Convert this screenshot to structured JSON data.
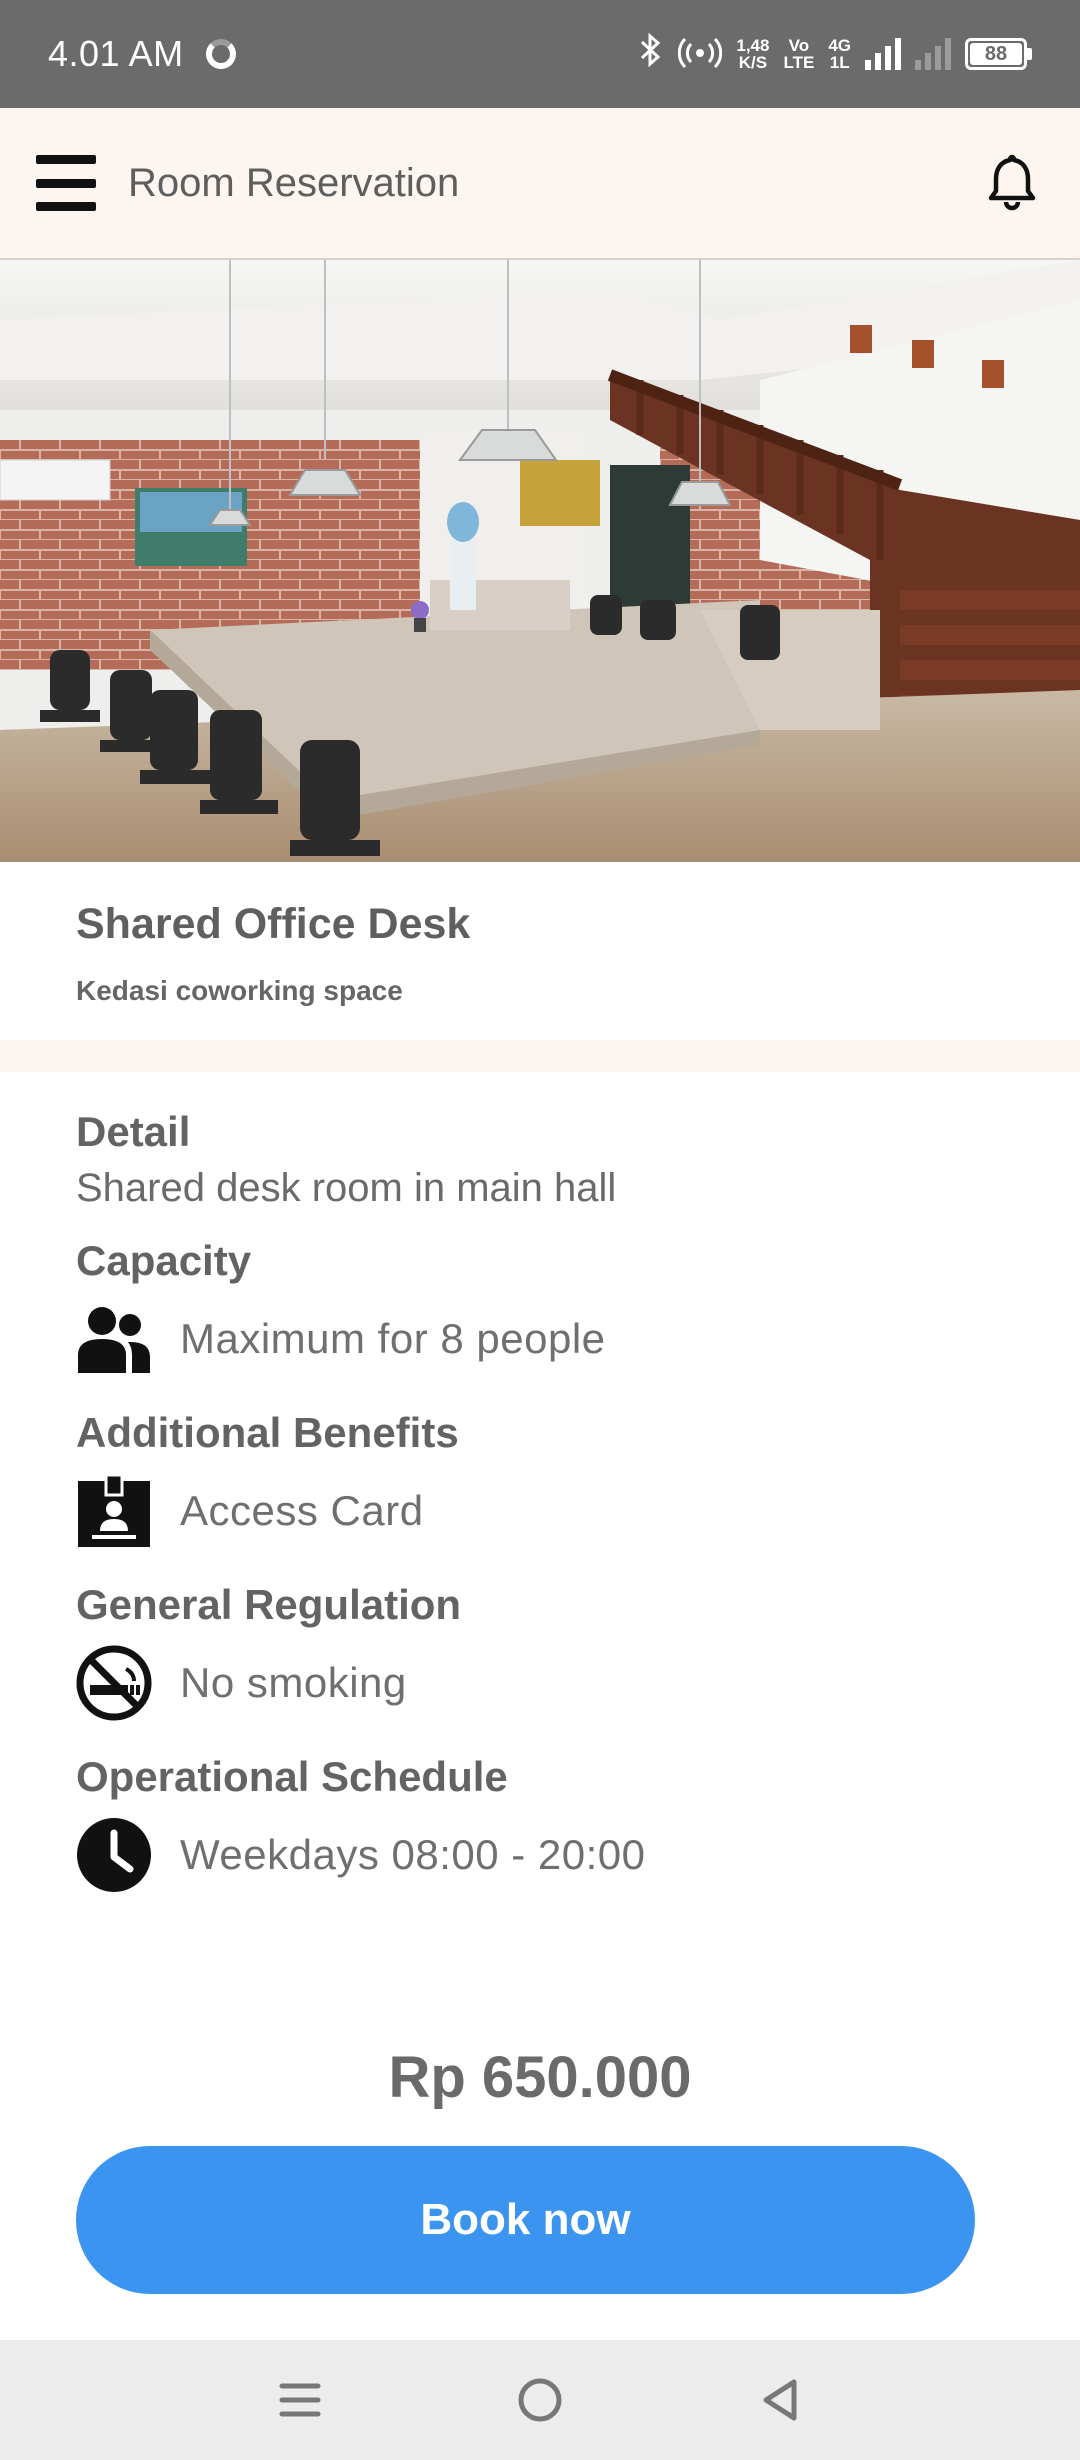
{
  "status_bar": {
    "time": "4.01 AM",
    "net_speed_value": "1,48",
    "net_speed_unit": "K/S",
    "volte_top": "Vo",
    "volte_bottom": "LTE",
    "network_top": "4G",
    "network_bottom": "1L",
    "battery": "88"
  },
  "app_bar": {
    "title": "Room Reservation"
  },
  "room": {
    "name": "Shared Office Desk",
    "place": "Kedasi coworking space"
  },
  "details": {
    "detail_title": "Detail",
    "detail_text": "Shared desk room in main hall",
    "capacity_title": "Capacity",
    "capacity_text": "Maximum for 8 people",
    "benefits_title": "Additional Benefits",
    "benefits_text": "Access Card",
    "regulation_title": "General Regulation",
    "regulation_text": "No smoking",
    "schedule_title": "Operational Schedule",
    "schedule_text": "Weekdays 08:00 - 20:00"
  },
  "price": "Rp 650.000",
  "book_button": "Book now",
  "icons": {
    "menu": "hamburger-menu-icon",
    "bell": "bell-icon",
    "capacity": "people-group-icon",
    "benefits": "id-badge-icon",
    "regulation": "no-smoking-icon",
    "schedule": "clock-icon"
  },
  "colors": {
    "accent": "#3b95f0",
    "app_bar_bg": "#fdf5ef",
    "status_bar_bg": "#6b6b6b"
  }
}
